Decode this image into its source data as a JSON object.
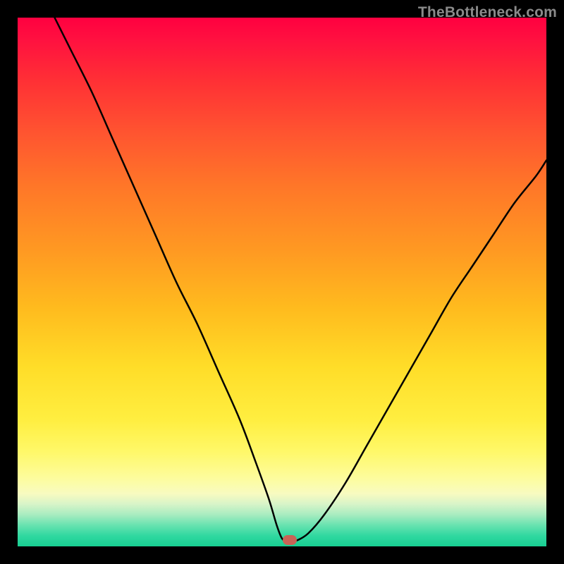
{
  "watermark": "TheBottleneck.com",
  "chart_data": {
    "type": "line",
    "title": "",
    "xlabel": "",
    "ylabel": "",
    "xlim": [
      0,
      100
    ],
    "ylim": [
      0,
      100
    ],
    "grid": false,
    "background_gradient": {
      "orientation": "vertical",
      "stops": [
        {
          "pos": 0.0,
          "color": "#ff0040"
        },
        {
          "pos": 0.3,
          "color": "#ff7728"
        },
        {
          "pos": 0.6,
          "color": "#ffdd28"
        },
        {
          "pos": 0.88,
          "color": "#fdfc9c"
        },
        {
          "pos": 1.0,
          "color": "#18cf92"
        }
      ]
    },
    "series": [
      {
        "name": "bottleneck-curve",
        "x": [
          7,
          10,
          14,
          18,
          22,
          26,
          30,
          34,
          38,
          42,
          45,
          47.5,
          49,
          50,
          51,
          52,
          53,
          55,
          58,
          62,
          66,
          70,
          74,
          78,
          82,
          86,
          90,
          94,
          98,
          100
        ],
        "y": [
          100,
          94,
          86,
          77,
          68,
          59,
          50,
          42,
          33,
          24,
          16,
          9,
          4,
          1.5,
          1,
          1,
          1.2,
          2.5,
          6,
          12,
          19,
          26,
          33,
          40,
          47,
          53,
          59,
          65,
          70,
          73
        ],
        "color": "#000000",
        "width": 2.5
      }
    ],
    "markers": [
      {
        "name": "optimal-point",
        "x": 51.5,
        "y": 1.2,
        "color": "#c96356",
        "shape": "pill"
      }
    ]
  }
}
